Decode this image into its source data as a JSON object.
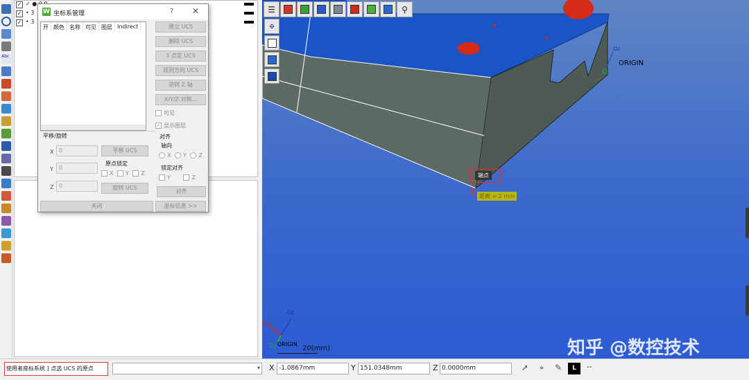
{
  "tree": {
    "rows": [
      {
        "label": "✓  ●  0 0",
        "checked": "✓"
      },
      {
        "label": "•  3",
        "checked": "✓"
      },
      {
        "label": "•  3",
        "checked": "✓"
      }
    ]
  },
  "dialog": {
    "logo": "W",
    "title": "坐标系管理",
    "help": "?",
    "close": "✕",
    "columns": [
      "开",
      "颜色",
      "名称",
      "可见",
      "图层",
      "Indirect"
    ],
    "buttons": {
      "create_ucs": "建立 UCS",
      "delete_ucs": "删除 UCS",
      "three_point_ucs": "3 点定 UCS",
      "view_dir_ucs": "观测方向 UCS",
      "reverse_z": "逆转 Z 轴",
      "xyz_align": "X/Y/Z 对称...",
      "translate_ucs": "平移 UCS",
      "rotate_ucs": "旋转 UCS",
      "align": "对齐",
      "close": "关闭",
      "coord_info": "坐标信息 >>"
    },
    "visible_label": "可见",
    "show_layer_label": "显示图层",
    "show_layer_checked": "✓",
    "translate_group": "平移/旋转",
    "align_group": "对齐",
    "axis_dir": "轴向",
    "axis_options": [
      "X",
      "Y",
      "Z"
    ],
    "origin_lock": "原点锁定",
    "lock_align": "锁定对齐",
    "lock_options_origin": [
      "X",
      "Y",
      "Z"
    ],
    "lock_options_align": [
      "Y",
      "Z"
    ],
    "fields": {
      "x_label": "X",
      "x_value": "0",
      "y_label": "Y",
      "y_value": "0",
      "z_label": "Z",
      "z_value": "0"
    }
  },
  "viewport": {
    "origin_label": "ORIGIN",
    "oz_label": "Oz",
    "snap_label": "端点",
    "distance_tip": "距离 = 2 mm",
    "axis_oz": "Oz",
    "axis_oy": "Oy",
    "axis_ox": "Ox",
    "axis_origin": "ORIGIN",
    "scale_label": "20(mm)",
    "watermark": "知乎 @数控技术",
    "colors": {
      "face_front": "#5c6a63",
      "face_side": "#4f5a54",
      "face_top": "#1a55c8",
      "hole": "#d42a1a"
    }
  },
  "status": {
    "prompt": "使用者座标系统 ] 点选 UCS 的原点",
    "x_label": "X",
    "x_value": "-1.0867mm",
    "y_label": "Y",
    "y_value": "151.0348mm",
    "z_label": "Z",
    "z_value": "0.0000mm",
    "l_button": "L",
    "dashes": "--"
  }
}
